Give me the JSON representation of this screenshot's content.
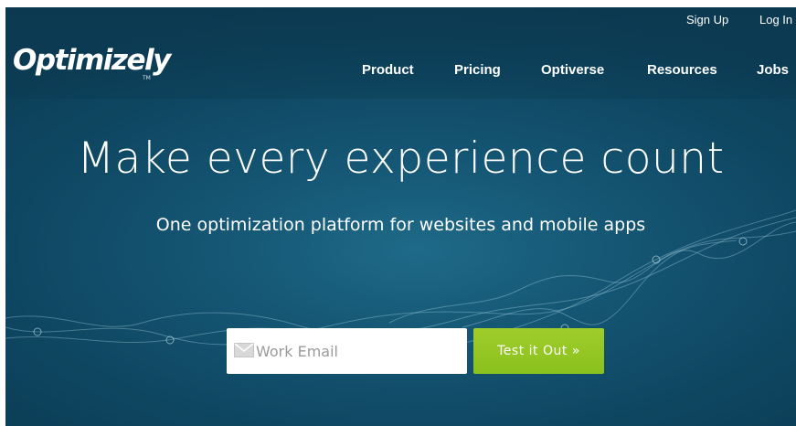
{
  "brand": {
    "logo_text": "Optimizely",
    "trademark": "TM"
  },
  "header": {
    "utility_links": [
      {
        "label": "Sign Up"
      },
      {
        "label": "Log In"
      }
    ],
    "nav": [
      {
        "label": "Product"
      },
      {
        "label": "Pricing"
      },
      {
        "label": "Optiverse"
      },
      {
        "label": "Resources"
      },
      {
        "label": "Jobs"
      }
    ]
  },
  "hero": {
    "headline": "Make every experience count",
    "subheadline": "One optimization platform for websites and mobile apps",
    "email_field": {
      "placeholder": "Work Email",
      "value": ""
    },
    "cta_label": "Test it Out »",
    "mail_icon": "envelope-icon"
  },
  "colors": {
    "background": "#155775",
    "cta": "#8ac11d",
    "text": "#ffffff"
  }
}
